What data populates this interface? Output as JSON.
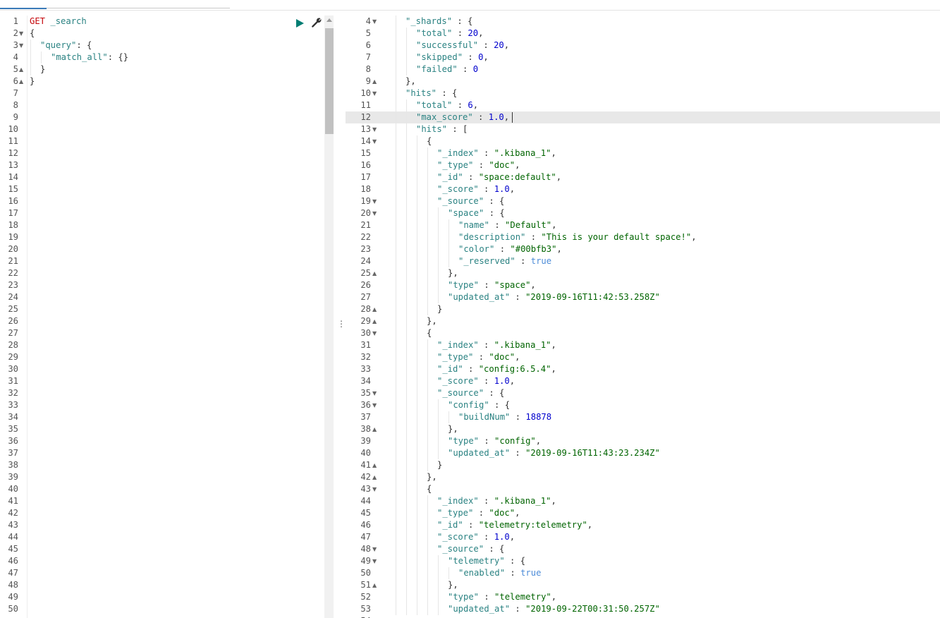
{
  "request_editor": {
    "line_numbers": [
      "1",
      "2",
      "3",
      "4",
      "5",
      "6",
      "7",
      "8",
      "9",
      "10",
      "11",
      "12",
      "13",
      "14",
      "15",
      "16",
      "17",
      "18",
      "19",
      "20",
      "21",
      "22",
      "23",
      "24",
      "25",
      "26",
      "27",
      "28",
      "29",
      "30",
      "31",
      "32",
      "33",
      "34",
      "35",
      "36",
      "37",
      "38",
      "39",
      "40",
      "41",
      "42",
      "43",
      "44",
      "45",
      "46",
      "47",
      "48",
      "49",
      "50"
    ],
    "lines": [
      {
        "indent": 0,
        "fold": "",
        "tokens": [
          [
            "method",
            "GET"
          ],
          [
            "punc",
            " "
          ],
          [
            "url",
            "_search"
          ]
        ]
      },
      {
        "indent": 0,
        "fold": "down",
        "tokens": [
          [
            "punc",
            "{"
          ]
        ]
      },
      {
        "indent": 1,
        "fold": "down",
        "tokens": [
          [
            "key",
            "\"query\""
          ],
          [
            "punc",
            ": {"
          ]
        ]
      },
      {
        "indent": 2,
        "fold": "",
        "tokens": [
          [
            "key",
            "\"match_all\""
          ],
          [
            "punc",
            ": {}"
          ]
        ]
      },
      {
        "indent": 1,
        "fold": "up",
        "tokens": [
          [
            "punc",
            "}"
          ]
        ]
      },
      {
        "indent": 0,
        "fold": "up",
        "tokens": [
          [
            "punc",
            "}"
          ]
        ]
      }
    ]
  },
  "response_viewer": {
    "first_line_number": 4,
    "active_line": 12,
    "lines": [
      {
        "indent": 1,
        "fold": "down",
        "tokens": [
          [
            "key",
            "\"_shards\""
          ],
          [
            "punc",
            " : {"
          ]
        ]
      },
      {
        "indent": 2,
        "fold": "",
        "tokens": [
          [
            "key",
            "\"total\""
          ],
          [
            "punc",
            " : "
          ],
          [
            "num",
            "20"
          ],
          [
            "punc",
            ","
          ]
        ]
      },
      {
        "indent": 2,
        "fold": "",
        "tokens": [
          [
            "key",
            "\"successful\""
          ],
          [
            "punc",
            " : "
          ],
          [
            "num",
            "20"
          ],
          [
            "punc",
            ","
          ]
        ]
      },
      {
        "indent": 2,
        "fold": "",
        "tokens": [
          [
            "key",
            "\"skipped\""
          ],
          [
            "punc",
            " : "
          ],
          [
            "num",
            "0"
          ],
          [
            "punc",
            ","
          ]
        ]
      },
      {
        "indent": 2,
        "fold": "",
        "tokens": [
          [
            "key",
            "\"failed\""
          ],
          [
            "punc",
            " : "
          ],
          [
            "num",
            "0"
          ]
        ]
      },
      {
        "indent": 1,
        "fold": "up",
        "tokens": [
          [
            "punc",
            "},"
          ]
        ]
      },
      {
        "indent": 1,
        "fold": "down",
        "tokens": [
          [
            "key",
            "\"hits\""
          ],
          [
            "punc",
            " : {"
          ]
        ]
      },
      {
        "indent": 2,
        "fold": "",
        "tokens": [
          [
            "key",
            "\"total\""
          ],
          [
            "punc",
            " : "
          ],
          [
            "num",
            "6"
          ],
          [
            "punc",
            ","
          ]
        ]
      },
      {
        "indent": 2,
        "fold": "",
        "tokens": [
          [
            "key",
            "\"max_score\""
          ],
          [
            "punc",
            " : "
          ],
          [
            "num",
            "1.0"
          ],
          [
            "punc",
            ","
          ]
        ]
      },
      {
        "indent": 2,
        "fold": "down",
        "tokens": [
          [
            "key",
            "\"hits\""
          ],
          [
            "punc",
            " : ["
          ]
        ]
      },
      {
        "indent": 3,
        "fold": "down",
        "tokens": [
          [
            "punc",
            "{"
          ]
        ]
      },
      {
        "indent": 4,
        "fold": "",
        "tokens": [
          [
            "key",
            "\"_index\""
          ],
          [
            "punc",
            " : "
          ],
          [
            "str",
            "\".kibana_1\""
          ],
          [
            "punc",
            ","
          ]
        ]
      },
      {
        "indent": 4,
        "fold": "",
        "tokens": [
          [
            "key",
            "\"_type\""
          ],
          [
            "punc",
            " : "
          ],
          [
            "str",
            "\"doc\""
          ],
          [
            "punc",
            ","
          ]
        ]
      },
      {
        "indent": 4,
        "fold": "",
        "tokens": [
          [
            "key",
            "\"_id\""
          ],
          [
            "punc",
            " : "
          ],
          [
            "str",
            "\"space:default\""
          ],
          [
            "punc",
            ","
          ]
        ]
      },
      {
        "indent": 4,
        "fold": "",
        "tokens": [
          [
            "key",
            "\"_score\""
          ],
          [
            "punc",
            " : "
          ],
          [
            "num",
            "1.0"
          ],
          [
            "punc",
            ","
          ]
        ]
      },
      {
        "indent": 4,
        "fold": "down",
        "tokens": [
          [
            "key",
            "\"_source\""
          ],
          [
            "punc",
            " : {"
          ]
        ]
      },
      {
        "indent": 5,
        "fold": "down",
        "tokens": [
          [
            "key",
            "\"space\""
          ],
          [
            "punc",
            " : {"
          ]
        ]
      },
      {
        "indent": 6,
        "fold": "",
        "tokens": [
          [
            "key",
            "\"name\""
          ],
          [
            "punc",
            " : "
          ],
          [
            "str",
            "\"Default\""
          ],
          [
            "punc",
            ","
          ]
        ]
      },
      {
        "indent": 6,
        "fold": "",
        "tokens": [
          [
            "key",
            "\"description\""
          ],
          [
            "punc",
            " : "
          ],
          [
            "str",
            "\"This is your default space!\""
          ],
          [
            "punc",
            ","
          ]
        ]
      },
      {
        "indent": 6,
        "fold": "",
        "tokens": [
          [
            "key",
            "\"color\""
          ],
          [
            "punc",
            " : "
          ],
          [
            "str",
            "\"#00bfb3\""
          ],
          [
            "punc",
            ","
          ]
        ]
      },
      {
        "indent": 6,
        "fold": "",
        "tokens": [
          [
            "key",
            "\"_reserved\""
          ],
          [
            "punc",
            " : "
          ],
          [
            "bool",
            "true"
          ]
        ]
      },
      {
        "indent": 5,
        "fold": "up",
        "tokens": [
          [
            "punc",
            "},"
          ]
        ]
      },
      {
        "indent": 5,
        "fold": "",
        "tokens": [
          [
            "key",
            "\"type\""
          ],
          [
            "punc",
            " : "
          ],
          [
            "str",
            "\"space\""
          ],
          [
            "punc",
            ","
          ]
        ]
      },
      {
        "indent": 5,
        "fold": "",
        "tokens": [
          [
            "key",
            "\"updated_at\""
          ],
          [
            "punc",
            " : "
          ],
          [
            "str",
            "\"2019-09-16T11:42:53.258Z\""
          ]
        ]
      },
      {
        "indent": 4,
        "fold": "up",
        "tokens": [
          [
            "punc",
            "}"
          ]
        ]
      },
      {
        "indent": 3,
        "fold": "up",
        "tokens": [
          [
            "punc",
            "},"
          ]
        ]
      },
      {
        "indent": 3,
        "fold": "down",
        "tokens": [
          [
            "punc",
            "{"
          ]
        ]
      },
      {
        "indent": 4,
        "fold": "",
        "tokens": [
          [
            "key",
            "\"_index\""
          ],
          [
            "punc",
            " : "
          ],
          [
            "str",
            "\".kibana_1\""
          ],
          [
            "punc",
            ","
          ]
        ]
      },
      {
        "indent": 4,
        "fold": "",
        "tokens": [
          [
            "key",
            "\"_type\""
          ],
          [
            "punc",
            " : "
          ],
          [
            "str",
            "\"doc\""
          ],
          [
            "punc",
            ","
          ]
        ]
      },
      {
        "indent": 4,
        "fold": "",
        "tokens": [
          [
            "key",
            "\"_id\""
          ],
          [
            "punc",
            " : "
          ],
          [
            "str",
            "\"config:6.5.4\""
          ],
          [
            "punc",
            ","
          ]
        ]
      },
      {
        "indent": 4,
        "fold": "",
        "tokens": [
          [
            "key",
            "\"_score\""
          ],
          [
            "punc",
            " : "
          ],
          [
            "num",
            "1.0"
          ],
          [
            "punc",
            ","
          ]
        ]
      },
      {
        "indent": 4,
        "fold": "down",
        "tokens": [
          [
            "key",
            "\"_source\""
          ],
          [
            "punc",
            " : {"
          ]
        ]
      },
      {
        "indent": 5,
        "fold": "down",
        "tokens": [
          [
            "key",
            "\"config\""
          ],
          [
            "punc",
            " : {"
          ]
        ]
      },
      {
        "indent": 6,
        "fold": "",
        "tokens": [
          [
            "key",
            "\"buildNum\""
          ],
          [
            "punc",
            " : "
          ],
          [
            "num",
            "18878"
          ]
        ]
      },
      {
        "indent": 5,
        "fold": "up",
        "tokens": [
          [
            "punc",
            "},"
          ]
        ]
      },
      {
        "indent": 5,
        "fold": "",
        "tokens": [
          [
            "key",
            "\"type\""
          ],
          [
            "punc",
            " : "
          ],
          [
            "str",
            "\"config\""
          ],
          [
            "punc",
            ","
          ]
        ]
      },
      {
        "indent": 5,
        "fold": "",
        "tokens": [
          [
            "key",
            "\"updated_at\""
          ],
          [
            "punc",
            " : "
          ],
          [
            "str",
            "\"2019-09-16T11:43:23.234Z\""
          ]
        ]
      },
      {
        "indent": 4,
        "fold": "up",
        "tokens": [
          [
            "punc",
            "}"
          ]
        ]
      },
      {
        "indent": 3,
        "fold": "up",
        "tokens": [
          [
            "punc",
            "},"
          ]
        ]
      },
      {
        "indent": 3,
        "fold": "down",
        "tokens": [
          [
            "punc",
            "{"
          ]
        ]
      },
      {
        "indent": 4,
        "fold": "",
        "tokens": [
          [
            "key",
            "\"_index\""
          ],
          [
            "punc",
            " : "
          ],
          [
            "str",
            "\".kibana_1\""
          ],
          [
            "punc",
            ","
          ]
        ]
      },
      {
        "indent": 4,
        "fold": "",
        "tokens": [
          [
            "key",
            "\"_type\""
          ],
          [
            "punc",
            " : "
          ],
          [
            "str",
            "\"doc\""
          ],
          [
            "punc",
            ","
          ]
        ]
      },
      {
        "indent": 4,
        "fold": "",
        "tokens": [
          [
            "key",
            "\"_id\""
          ],
          [
            "punc",
            " : "
          ],
          [
            "str",
            "\"telemetry:telemetry\""
          ],
          [
            "punc",
            ","
          ]
        ]
      },
      {
        "indent": 4,
        "fold": "",
        "tokens": [
          [
            "key",
            "\"_score\""
          ],
          [
            "punc",
            " : "
          ],
          [
            "num",
            "1.0"
          ],
          [
            "punc",
            ","
          ]
        ]
      },
      {
        "indent": 4,
        "fold": "down",
        "tokens": [
          [
            "key",
            "\"_source\""
          ],
          [
            "punc",
            " : {"
          ]
        ]
      },
      {
        "indent": 5,
        "fold": "down",
        "tokens": [
          [
            "key",
            "\"telemetry\""
          ],
          [
            "punc",
            " : {"
          ]
        ]
      },
      {
        "indent": 6,
        "fold": "",
        "tokens": [
          [
            "key",
            "\"enabled\""
          ],
          [
            "punc",
            " : "
          ],
          [
            "bool",
            "true"
          ]
        ]
      },
      {
        "indent": 5,
        "fold": "up",
        "tokens": [
          [
            "punc",
            "},"
          ]
        ]
      },
      {
        "indent": 5,
        "fold": "",
        "tokens": [
          [
            "key",
            "\"type\""
          ],
          [
            "punc",
            " : "
          ],
          [
            "str",
            "\"telemetry\""
          ],
          [
            "punc",
            ","
          ]
        ]
      },
      {
        "indent": 5,
        "fold": "",
        "tokens": [
          [
            "key",
            "\"updated_at\""
          ],
          [
            "punc",
            " : "
          ],
          [
            "str",
            "\"2019-09-22T00:31:50.257Z\""
          ]
        ]
      }
    ]
  },
  "toolbar": {
    "play_icon": "play-icon",
    "wrench_icon": "wrench-icon"
  },
  "resize_handle_glyph": "⋮",
  "colors": {
    "method": "#c5060b",
    "key": "#2a8282",
    "string": "#006400",
    "number": "#0000cd",
    "boolean": "#4d8cd8",
    "play": "#017d73",
    "active_line": "#e8e8e8"
  }
}
